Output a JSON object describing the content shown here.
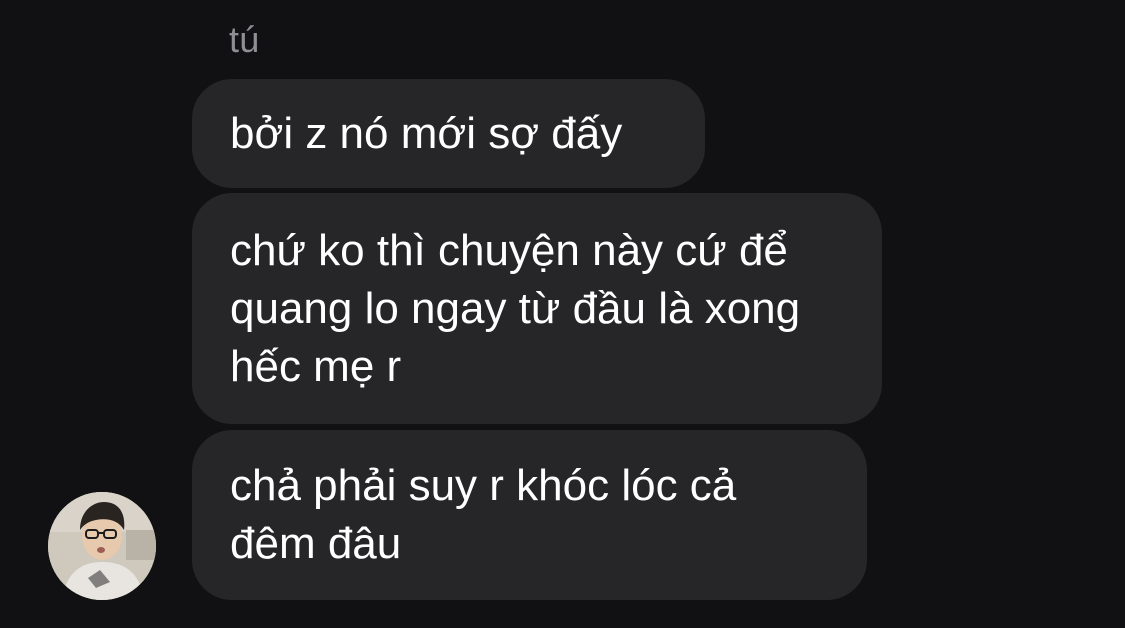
{
  "sender": {
    "name": "tú"
  },
  "messages": [
    {
      "text": "bởi z nó mới sợ đấy"
    },
    {
      "text": "chứ ko thì chuyện này cứ để quang lo ngay từ đầu là xong hếc mẹ r"
    },
    {
      "text": "chả phải suy r khóc lóc cả đêm đâu"
    }
  ],
  "avatar": {
    "icon": "user-photo-avatar"
  },
  "colors": {
    "background": "#111113",
    "bubble": "#262628",
    "text": "#ffffff",
    "sender_name": "#8e8e93"
  }
}
